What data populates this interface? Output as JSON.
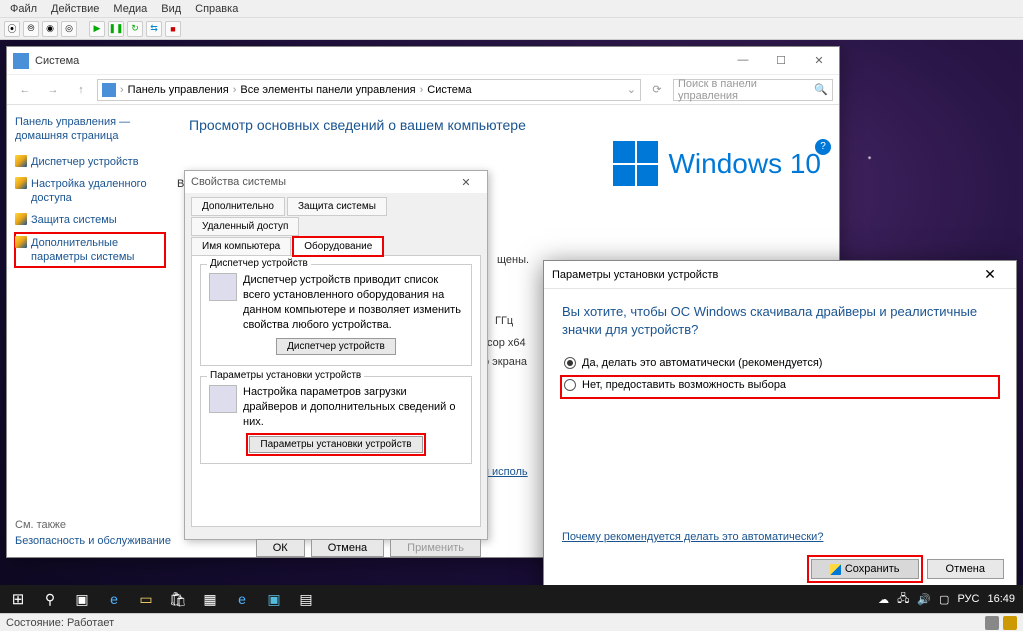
{
  "vm": {
    "menu": [
      "Файл",
      "Действие",
      "Медиа",
      "Вид",
      "Справка"
    ],
    "status_label": "Состояние:",
    "status_value": "Работает"
  },
  "system_window": {
    "title": "Система",
    "breadcrumb": [
      "Панель управления",
      "Все элементы панели управления",
      "Система"
    ],
    "search_placeholder": "Поиск в панели управления",
    "sidebar": {
      "home": "Панель управления — домашняя страница",
      "items": [
        "Диспетчер устройств",
        "Настройка удаленного доступа",
        "Защита системы",
        "Дополнительные параметры системы"
      ],
      "see_also": "См. также",
      "security": "Безопасность и обслуживание"
    },
    "heading": "Просмотр основных сведений о вашем компьютере",
    "peek_lines": [
      "Вы",
      "щены.",
      "ГГц",
      "сор x64",
      "о экрана"
    ],
    "peek_link": "я исполь",
    "logo_text": "Windows 10"
  },
  "sysprops": {
    "title": "Свойства системы",
    "tabs_row1": [
      "Дополнительно",
      "Защита системы",
      "Удаленный доступ"
    ],
    "tabs_row2": [
      "Имя компьютера",
      "Оборудование"
    ],
    "group1": {
      "title": "Диспетчер устройств",
      "text": "Диспетчер устройств приводит список всего установленного оборудования на данном компьютере и позволяет изменить свойства любого устройства.",
      "button": "Диспетчер устройств"
    },
    "group2": {
      "title": "Параметры установки устройств",
      "text": "Настройка параметров загрузки драйверов и дополнительных сведений о них.",
      "button": "Параметры установки устройств"
    },
    "buttons": {
      "ok": "ОК",
      "cancel": "Отмена",
      "apply": "Применить"
    }
  },
  "devset": {
    "title": "Параметры установки устройств",
    "question": "Вы хотите, чтобы ОС Windows скачивала драйверы и реалистичные значки для устройств?",
    "opt_yes": "Да, делать это автоматически (рекомендуется)",
    "opt_no": "Нет, предоставить возможность выбора",
    "link": "Почему рекомендуется делать это автоматически?",
    "save": "Сохранить",
    "cancel": "Отмена"
  },
  "taskbar": {
    "lang": "РУС",
    "clock": "16:49"
  }
}
